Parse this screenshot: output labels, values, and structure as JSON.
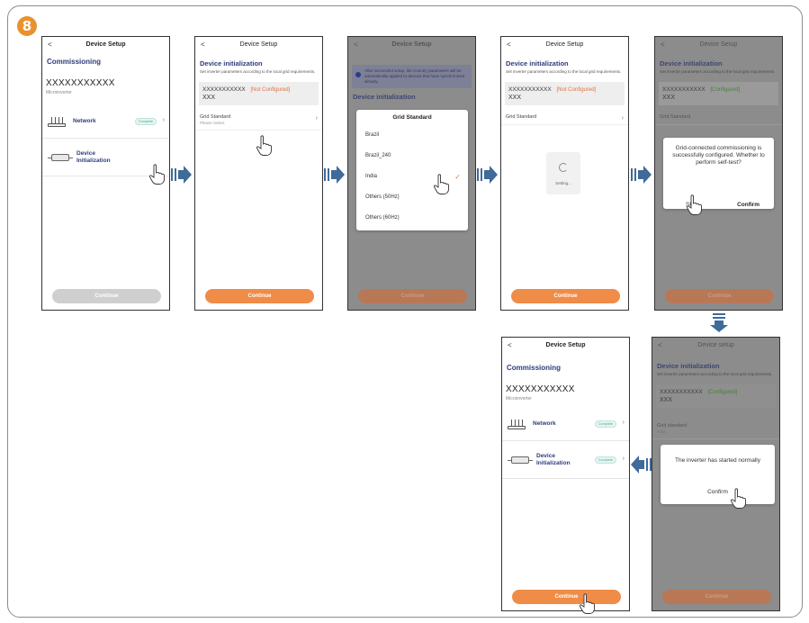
{
  "step_number": "8",
  "colors": {
    "accent": "#ef8c48",
    "title": "#2d3c7a",
    "badge": "#4aa99a",
    "arrow": "#3f6a9a"
  },
  "icons": [
    "back-icon",
    "chevron-right-icon",
    "router-icon",
    "microinverter-icon",
    "hand-pointer-icon",
    "check-icon",
    "info-icon",
    "spinner-icon",
    "arrow-right-icon",
    "arrow-down-icon",
    "arrow-left-icon"
  ],
  "screens": {
    "s1": {
      "back": "<",
      "title": "Device Setup",
      "section": "Commissioning",
      "sn": "XXXXXXXXXXX",
      "type": "Microinverter",
      "network": "Network",
      "network_badge": "Complete",
      "device_init": "Device Initialization",
      "button": "Continue"
    },
    "s2": {
      "back": "<",
      "title": "Device Setup",
      "heading": "Device initialization",
      "desc": "Set inverter parameters according to the local grid requirements.",
      "sn": "XXXXXXXXXXX",
      "status": "[Not Configured]",
      "model": "XXX",
      "grid_label": "Grid Standard",
      "grid_placeholder": "Please Select",
      "button": "Continue"
    },
    "s3": {
      "back": "<",
      "title": "Device Setup",
      "notice": "After successful setup, the Country parameters will be automatically applied to devices that have synchronized already.",
      "heading": "Device initialization",
      "popup_title": "Grid Standard",
      "options": [
        "Brazil",
        "Brazil_240",
        "India",
        "Others (50Hz)",
        "Others (60Hz)"
      ],
      "button": "Continue"
    },
    "s4": {
      "back": "<",
      "title": "Device Setup",
      "heading": "Device initialization",
      "desc": "Set inverter parameters according to the local grid requirements.",
      "sn": "XXXXXXXXXXX",
      "status": "[Not Configured]",
      "model": "XXX",
      "grid_label": "Grid Standard",
      "spinner_text": "Setting...",
      "button": "Continue"
    },
    "s5": {
      "back": "<",
      "title": "Device Setup",
      "heading": "Device initialization",
      "desc": "Set inverter parameters according to the local grid requirements.",
      "sn": "XXXXXXXXXXX",
      "status": "[Configured]",
      "model": "XXX",
      "grid_label": "Grid Standard",
      "dialog_text": "Grid-connected commissioning is successfully configured. Whether to perform self-test?",
      "skip": "Skip",
      "confirm": "Confirm",
      "button": "Continue"
    },
    "s6": {
      "back": "<",
      "title": "Device setup",
      "heading": "Device initialization",
      "desc": "Set inverter parameters according to the local grid requirements.",
      "sn": "XXXXXXXXXXX",
      "status": "[Configured]",
      "model": "XXX",
      "grid_label": "Grid standard",
      "grid_value": "India",
      "dialog_text": "The inverter has started normally",
      "confirm": "Confirm",
      "button": "Continue"
    },
    "s7": {
      "back": "<",
      "title": "Device Setup",
      "section": "Commissioning",
      "sn": "XXXXXXXXXXX",
      "type": "Microinverter",
      "network": "Network",
      "network_badge": "Complete",
      "device_init": "Device Initialization",
      "device_badge": "Complete",
      "button": "Continue"
    }
  }
}
